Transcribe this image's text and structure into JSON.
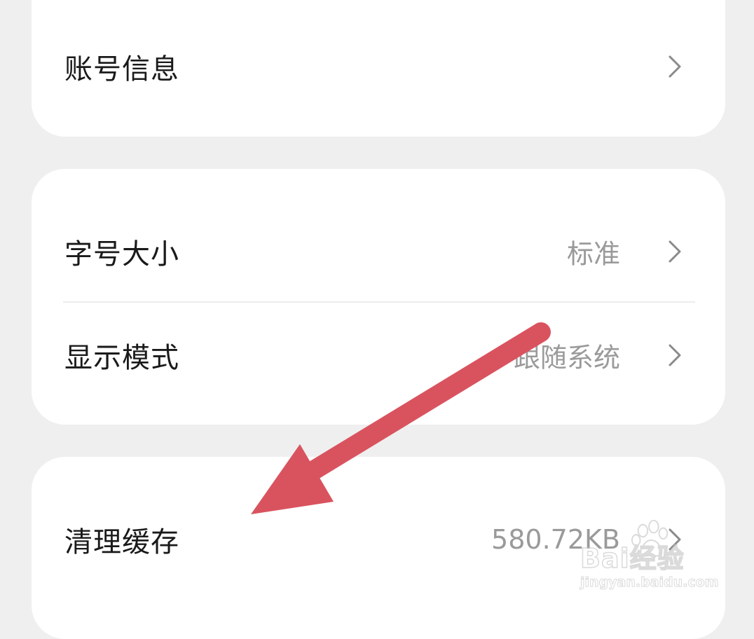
{
  "settings": {
    "account": {
      "label": "账号信息"
    },
    "font_size": {
      "label": "字号大小",
      "value": "标准"
    },
    "display_mode": {
      "label": "显示模式",
      "value": "跟随系统"
    },
    "clear_cache": {
      "label": "清理缓存",
      "value": "580.72KB"
    }
  },
  "annotation": {
    "arrow_color": "#d9535f"
  },
  "watermark": {
    "brand": "Bai经验",
    "url": "jingyan.baidu.com"
  },
  "colors": {
    "background": "#efefef",
    "card": "#ffffff",
    "label": "#1a1a1a",
    "value": "#9a9a9a"
  }
}
